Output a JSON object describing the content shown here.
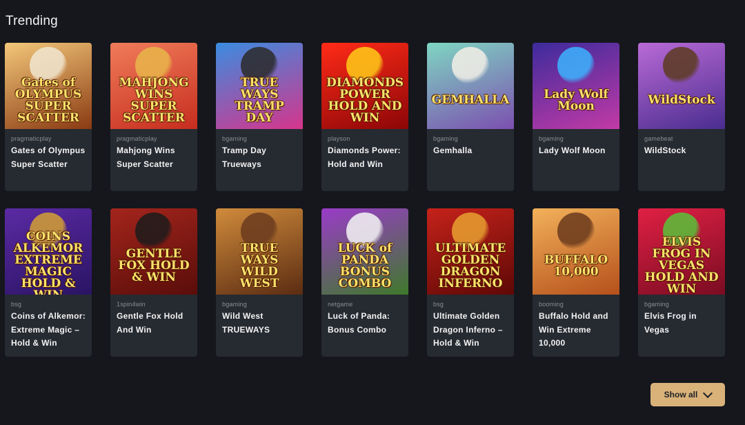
{
  "section": {
    "title": "Trending"
  },
  "games": [
    {
      "provider": "pragmaticplay",
      "name": "Gates of Olympus Super Scatter",
      "art_text": "Gates of OLYMPUS SUPER SCATTER",
      "colors": [
        "#f3c77a",
        "#8a3a12"
      ],
      "char": "#f1e6d0"
    },
    {
      "provider": "pragmaticplay",
      "name": "Mahjong Wins Super Scatter",
      "art_text": "MAHJONG WINS SUPER SCATTER",
      "colors": [
        "#f07c5a",
        "#c62d1e"
      ],
      "char": "#e8b64a"
    },
    {
      "provider": "bgaming",
      "name": "Tramp Day Trueways",
      "art_text": "TRUE WAYS TRAMP DAY",
      "colors": [
        "#3a8ce0",
        "#d6358b"
      ],
      "char": "#2a2a2a"
    },
    {
      "provider": "playson",
      "name": "Diamonds Power: Hold and Win",
      "art_text": "DIAMONDS POWER HOLD AND WIN",
      "colors": [
        "#ff2b17",
        "#8c0608"
      ],
      "char": "#ffcc18"
    },
    {
      "provider": "bgaming",
      "name": "Gemhalla",
      "art_text": "GEMHALLA",
      "colors": [
        "#7ed6c2",
        "#7c4fb0"
      ],
      "char": "#f3efe6"
    },
    {
      "provider": "bgaming",
      "name": "Lady Wolf Moon",
      "art_text": "Lady Wolf Moon",
      "colors": [
        "#3d2b9c",
        "#c23aa6"
      ],
      "char": "#3cb3ff"
    },
    {
      "provider": "gamebeat",
      "name": "WildStock",
      "art_text": "WildStock",
      "colors": [
        "#b96ad6",
        "#4a2d8f"
      ],
      "char": "#5c3a20"
    },
    {
      "provider": "bsg",
      "name": "Coins of Alkemor: Extreme Magic – Hold & Win",
      "art_text": "COINS ALKEMOR EXTREME MAGIC HOLD & WIN",
      "colors": [
        "#5b2aa3",
        "#2a1464"
      ],
      "char": "#d4a033"
    },
    {
      "provider": "1spin4win",
      "name": "Gentle Fox Hold And Win",
      "art_text": "GENTLE FOX HOLD & WIN",
      "colors": [
        "#a3251c",
        "#5a0d0a"
      ],
      "char": "#1b1b1b"
    },
    {
      "provider": "bgaming",
      "name": "Wild West TRUEWAYS",
      "art_text": "TRUE WAYS WILD WEST",
      "colors": [
        "#d08b3b",
        "#5b2c12"
      ],
      "char": "#6b3b1e"
    },
    {
      "provider": "netgame",
      "name": "Luck of Panda: Bonus Combo",
      "art_text": "LUCK of PANDA BONUS COMBO",
      "colors": [
        "#9a3bc8",
        "#3e7a2a"
      ],
      "char": "#f5f5f5"
    },
    {
      "provider": "bsg",
      "name": "Ultimate Golden Dragon Inferno – Hold & Win",
      "art_text": "ULTIMATE GOLDEN DRAGON INFERNO",
      "colors": [
        "#c5221a",
        "#5e0806"
      ],
      "char": "#e8a030"
    },
    {
      "provider": "booming",
      "name": "Buffalo Hold and Win Extreme 10,000",
      "art_text": "BUFFALO 10,000",
      "colors": [
        "#f2b15a",
        "#b5501b"
      ],
      "char": "#6a3a1c"
    },
    {
      "provider": "bgaming",
      "name": "Elvis Frog in Vegas",
      "art_text": "ELVIS FROG IN VEGAS HOLD AND WIN",
      "colors": [
        "#e02044",
        "#7a0c22"
      ],
      "char": "#58c23a"
    }
  ],
  "show_all": {
    "label": "Show all"
  }
}
